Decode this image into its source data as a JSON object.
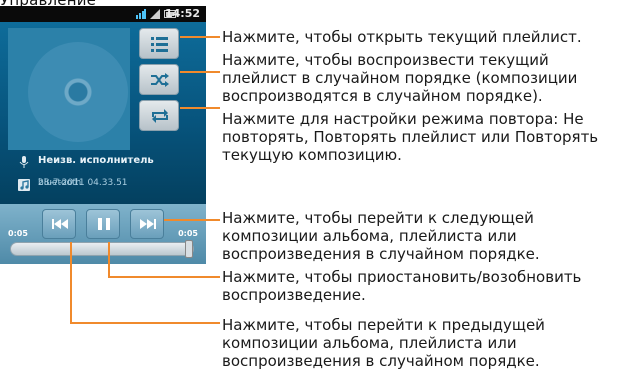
{
  "top_text": "Управление",
  "status_bar": {
    "time": "14:52",
    "icons": [
      "sim-signal-icon",
      "signal-bars-icon",
      "battery-icon"
    ]
  },
  "side_buttons": [
    {
      "icon": "playlist-icon"
    },
    {
      "icon": "shuffle-icon"
    },
    {
      "icon": "repeat-icon"
    }
  ],
  "track_info": {
    "artist": "Неизв. исполнитель",
    "album": "bluetooth",
    "title": "28-7-2011  04.33.51"
  },
  "playback": {
    "elapsed": "0:05",
    "total": "0:05",
    "progress": 1.0,
    "buttons": [
      {
        "icon": "previous-icon"
      },
      {
        "icon": "pause-icon"
      },
      {
        "icon": "next-icon"
      }
    ]
  },
  "annotations": [
    "Нажмите, чтобы открыть текущий плейлист.",
    "Нажмите, чтобы воспроизвести текущий плейлист в  случайном порядке (композиции воспроизводятся в случайном порядке).",
    "Нажмите для настройки режима повтора: Не повторять, Повторять плейлист или Повторять текущую композицию.",
    "Нажмите, чтобы перейти к следующей композиции альбома, плейлиста или воспроизведения в случайном порядке.",
    "Нажмите, чтобы приостановить/возобновить воспроизведение.",
    "Нажмите, чтобы перейти к предыдущей композиции альбома, плейлиста или воспроизведения в случайном порядке."
  ],
  "colors": {
    "accent": "#f08a2c",
    "screen": "#0a5f8c"
  }
}
